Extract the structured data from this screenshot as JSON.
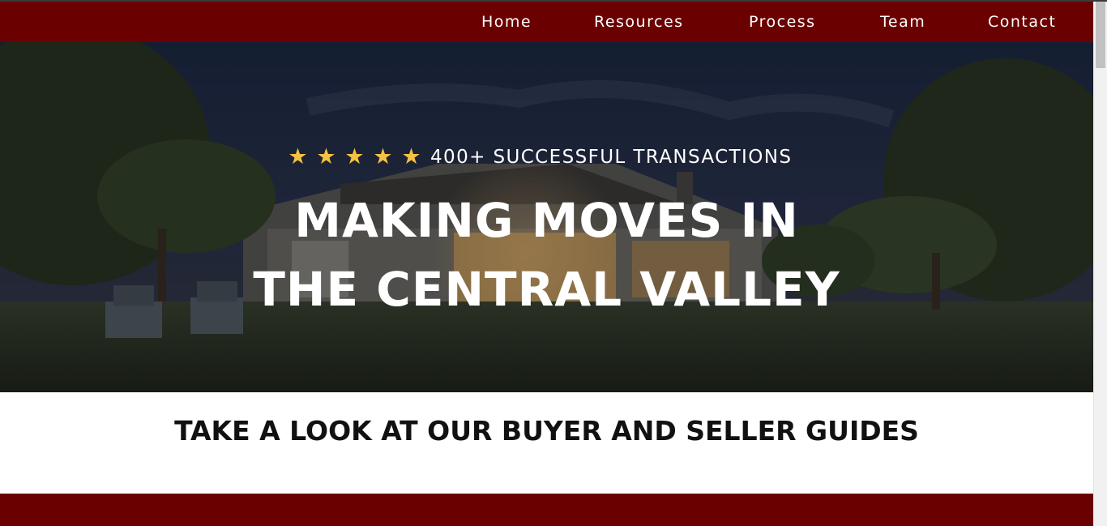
{
  "nav": {
    "links": [
      {
        "label": "Home"
      },
      {
        "label": "Resources"
      },
      {
        "label": "Process"
      },
      {
        "label": "Team"
      },
      {
        "label": "Contact"
      }
    ]
  },
  "hero": {
    "rating_stars": 5,
    "rating_text": "400+ SUCCESSFUL TRANSACTIONS",
    "title_line1": "MAKING MOVES IN",
    "title_line2": "THE CENTRAL VALLEY"
  },
  "guides": {
    "heading": "TAKE A LOOK AT OUR BUYER AND SELLER GUIDES"
  },
  "colors": {
    "brand": "#6b0000",
    "star": "#f5c242",
    "text_on_dark": "#ffffff",
    "heading_dark": "#111111"
  },
  "icons": [
    "star-icon"
  ]
}
